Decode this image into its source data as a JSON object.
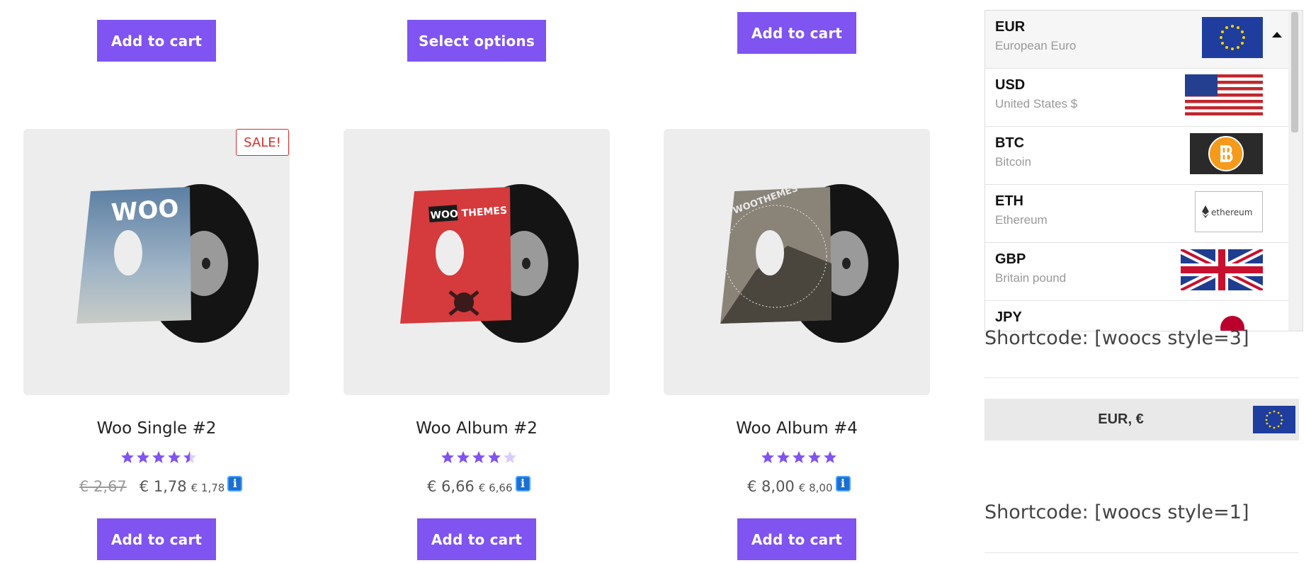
{
  "top_buttons": {
    "b1": "Add to cart",
    "b2": "Select options",
    "b3": "Add to cart"
  },
  "products": [
    {
      "title": "Woo Single #2",
      "badge": "SALE!",
      "rating": 4.5,
      "old_price": "€ 2,67",
      "price": "€ 1,78",
      "price_small": "€ 1,78",
      "button": "Add to cart",
      "art": "WOO"
    },
    {
      "title": "Woo Album #2",
      "rating": 4,
      "price": "€ 6,66",
      "price_small": "€ 6,66",
      "button": "Add to cart",
      "art": "WOO THEMES"
    },
    {
      "title": "Woo Album #4",
      "rating": 5,
      "price": "€ 8,00",
      "price_small": "€ 8,00",
      "button": "Add to cart",
      "art": "WOOTHEMES"
    }
  ],
  "info_icon_glyph": "i",
  "currencies": [
    {
      "code": "EUR",
      "name": "European Euro",
      "flag": "eu-flag-icon"
    },
    {
      "code": "USD",
      "name": "United States $",
      "flag": "us-flag-icon"
    },
    {
      "code": "BTC",
      "name": "Bitcoin",
      "flag": "bitcoin-icon"
    },
    {
      "code": "ETH",
      "name": "Ethereum",
      "flag": "ethereum-icon",
      "flag_text": "ethereum"
    },
    {
      "code": "GBP",
      "name": "Britain pound",
      "flag": "uk-flag-icon"
    },
    {
      "code": "JPY",
      "name": "",
      "flag": "japan-flag-icon"
    }
  ],
  "shortcode1": "Shortcode: [woocs style=3]",
  "selected_bar": "EUR, €",
  "shortcode2": "Shortcode: [woocs style=1]",
  "colors": {
    "accent": "#7f54f0",
    "sale": "#d43030",
    "star": "#7f54f0",
    "star_empty": "#d9ccfb"
  }
}
